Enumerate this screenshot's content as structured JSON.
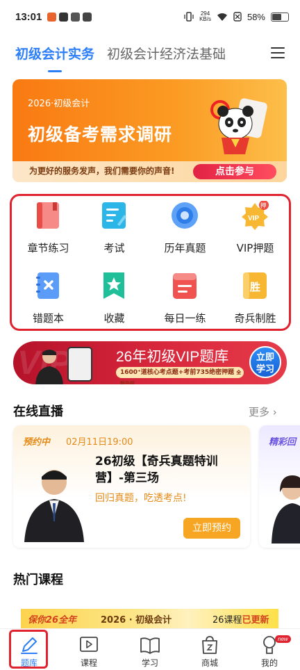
{
  "status_bar": {
    "time": "13:01",
    "net_speed_value": "294",
    "net_speed_unit": "KB/s",
    "battery": "58%"
  },
  "top_nav": {
    "tabs": [
      {
        "label": "初级会计实务",
        "active": true
      },
      {
        "label": "初级会计经济法基础",
        "active": false
      }
    ]
  },
  "survey_banner": {
    "tag": "2026·初级会计",
    "title": "初级备考需求调研",
    "subtitle": "为更好的服务发声，我们需要你的声音!",
    "cta": "点击参与"
  },
  "feature_grid": {
    "items": [
      {
        "label": "章节练习",
        "icon": "chapter-practice-icon",
        "color": "#f0534f"
      },
      {
        "label": "考试",
        "icon": "exam-icon",
        "color": "#27b3e6"
      },
      {
        "label": "历年真题",
        "icon": "past-papers-icon",
        "color": "#3d8bf6"
      },
      {
        "label": "VIP押题",
        "icon": "vip-prediction-icon",
        "color": "#f7b733",
        "badge": "押"
      },
      {
        "label": "错题本",
        "icon": "mistake-book-icon",
        "color": "#3d8bf6"
      },
      {
        "label": "收藏",
        "icon": "favorites-icon",
        "color": "#1fbf9a"
      },
      {
        "label": "每日一练",
        "icon": "daily-practice-icon",
        "color": "#f0534f"
      },
      {
        "label": "奇兵制胜",
        "icon": "surprise-win-icon",
        "color": "#f7b733",
        "glyph": "胜"
      }
    ]
  },
  "vip_banner": {
    "bg_text": "VIP",
    "headline": "26年初级VIP题库",
    "pill": "1600⁺道核心考点题+考前735绝密押题",
    "pill_badge": "全新升级",
    "button": "立即学习"
  },
  "live_section": {
    "title": "在线直播",
    "more": "更多",
    "cards": [
      {
        "tag": "预约中",
        "date": "02月11日19:00",
        "title": "26初级【奇兵真题特训营】-第三场",
        "subtitle": "回归真题，吃透考点!",
        "button": "立即预约"
      },
      {
        "tag": "精彩回"
      }
    ]
  },
  "hot_section": {
    "title": "热门课程",
    "banner_a": "保你26全年",
    "banner_b": "2026 · 初级会计",
    "banner_c_prefix": "26课程",
    "banner_c_highlight": "已更新"
  },
  "tab_bar": {
    "items": [
      {
        "label": "题库",
        "active": true
      },
      {
        "label": "课程",
        "active": false
      },
      {
        "label": "学习",
        "active": false
      },
      {
        "label": "商城",
        "active": false
      },
      {
        "label": "我的",
        "active": false,
        "badge": "new"
      }
    ]
  }
}
